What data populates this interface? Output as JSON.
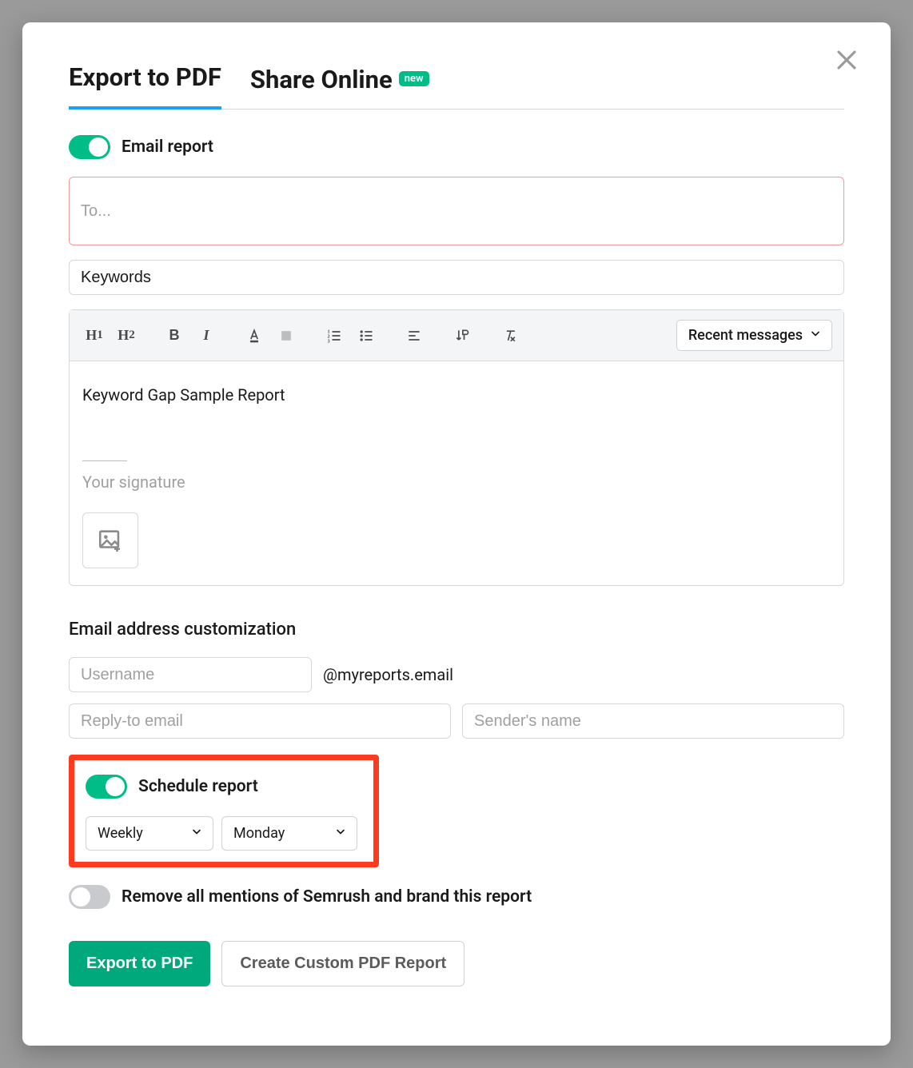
{
  "tabs": {
    "export": "Export to PDF",
    "share": "Share Online",
    "new_badge": "new"
  },
  "email_report": {
    "label": "Email report"
  },
  "fields": {
    "to_placeholder": "To...",
    "subject_value": "Keywords"
  },
  "editor": {
    "recent_label": "Recent messages",
    "body_text": "Keyword Gap Sample Report",
    "signature_placeholder": "Your signature"
  },
  "customization": {
    "title": "Email address customization",
    "username_placeholder": "Username",
    "domain": "@myreports.email",
    "reply_placeholder": "Reply-to email",
    "sender_placeholder": "Sender's name"
  },
  "schedule": {
    "label": "Schedule report",
    "frequency": "Weekly",
    "day": "Monday"
  },
  "brand_toggle": {
    "label": "Remove all mentions of Semrush and brand this report"
  },
  "buttons": {
    "export": "Export to PDF",
    "custom": "Create Custom PDF Report"
  },
  "toolbar": {
    "h1": "H",
    "h1_sub": "1",
    "h2": "H",
    "h2_sub": "2"
  }
}
